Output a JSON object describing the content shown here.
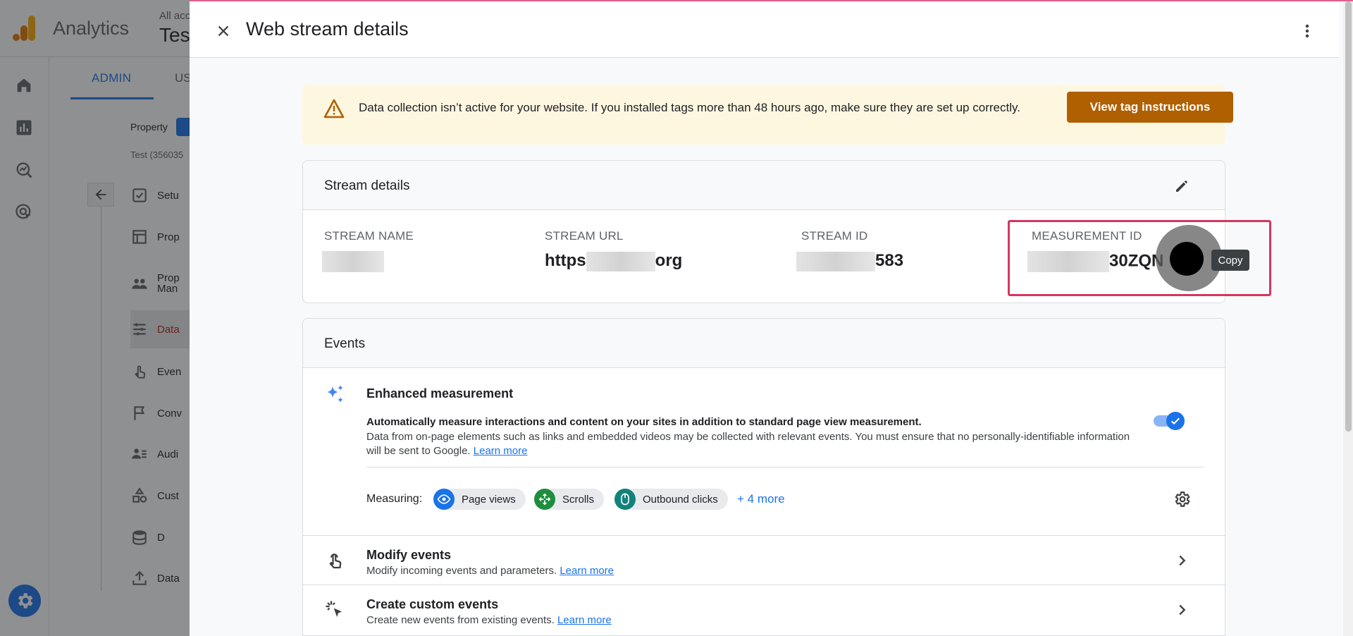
{
  "app": {
    "name": "Analytics",
    "account_crumb": "All acc",
    "property_name": "Tes"
  },
  "admin_nav": {
    "tabs": [
      {
        "label": "ADMIN"
      },
      {
        "label": "US"
      }
    ],
    "property_label": "Property",
    "property_sub": "Test (356035",
    "items": [
      {
        "label": "Setu",
        "icon": "checklist-icon"
      },
      {
        "label": "Prop",
        "icon": "property-settings-icon"
      },
      {
        "label": "Prop\nMan",
        "icon": "people-icon"
      },
      {
        "label": "Data",
        "icon": "data-streams-icon"
      },
      {
        "label": "Even",
        "icon": "touch-icon"
      },
      {
        "label": "Conv",
        "icon": "flag-icon"
      },
      {
        "label": "Audi",
        "icon": "audience-icon"
      },
      {
        "label": "Cust",
        "icon": "shapes-icon"
      },
      {
        "label": "D",
        "icon": "database-icon"
      },
      {
        "label": "Data",
        "icon": "upload-icon"
      }
    ]
  },
  "drawer": {
    "title": "Web stream details",
    "banner": {
      "text": "Data collection isn’t active for your website. If you installed tags more than 48 hours ago, make sure they are set up correctly.",
      "button_label": "View tag instructions"
    },
    "stream_details": {
      "title": "Stream details",
      "fields": {
        "stream_name": {
          "label": "STREAM NAME",
          "value_visible": ""
        },
        "stream_url": {
          "label": "STREAM URL",
          "value_prefix": "https",
          "value_suffix": "org"
        },
        "stream_id": {
          "label": "STREAM ID",
          "value_suffix": "583"
        },
        "measurement_id": {
          "label": "MEASUREMENT ID",
          "value_suffix": "30ZQN"
        }
      },
      "copy_tooltip": "Copy"
    },
    "events": {
      "title": "Events",
      "enhanced_measurement": {
        "title": "Enhanced measurement",
        "description_bold": "Automatically measure interactions and content on your sites in addition to standard page view measurement.",
        "description": "Data from on-page elements such as links and embedded videos may be collected with relevant events. You must ensure that no personally-identifiable information will be sent to Google.",
        "learn_more": "Learn more",
        "enabled": true,
        "measuring_label": "Measuring:",
        "chips": [
          {
            "label": "Page views",
            "icon": "eye-icon",
            "color": "#1a73e8"
          },
          {
            "label": "Scrolls",
            "icon": "scroll-arrows-icon",
            "color": "#1e8e3e"
          },
          {
            "label": "Outbound clicks",
            "icon": "mouse-icon",
            "color": "#12827a"
          }
        ],
        "more_label": "+ 4 more"
      },
      "rows": [
        {
          "title": "Modify events",
          "subtitle": "Modify incoming events and parameters.",
          "learn_more": "Learn more",
          "icon": "touch-icon"
        },
        {
          "title": "Create custom events",
          "subtitle": "Create new events from existing events.",
          "learn_more": "Learn more",
          "icon": "sparkle-cursor-icon"
        }
      ]
    }
  },
  "colors": {
    "accent": "#1a73e8",
    "warning_button": "#b06000",
    "banner_bg": "#fef7e0",
    "highlight": "#d6365f"
  }
}
